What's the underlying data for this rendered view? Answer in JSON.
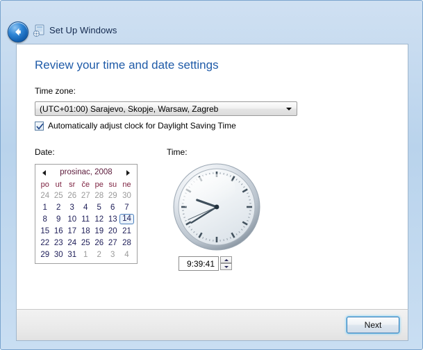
{
  "window": {
    "title": "Set Up Windows",
    "back_icon": "back-arrow-icon",
    "setup_icon": "windows-setup-icon"
  },
  "page": {
    "title": "Review your time and date settings"
  },
  "timezone": {
    "label": "Time zone:",
    "selected": "(UTC+01:00) Sarajevo, Skopje, Warsaw, Zagreb",
    "dropdown_icon": "chevron-down-icon"
  },
  "daylight_saving": {
    "label": "Automatically adjust clock for Daylight Saving Time",
    "checked": true,
    "check_icon": "checkmark-icon"
  },
  "date": {
    "label": "Date:",
    "month_year": "prosinac, 2008",
    "prev_icon": "triangle-left-icon",
    "next_icon": "triangle-right-icon",
    "weekdays": [
      "po",
      "ut",
      "sr",
      "če",
      "pe",
      "su",
      "ne"
    ],
    "weeks": [
      [
        {
          "d": "24",
          "adj": true
        },
        {
          "d": "25",
          "adj": true
        },
        {
          "d": "26",
          "adj": true
        },
        {
          "d": "27",
          "adj": true
        },
        {
          "d": "28",
          "adj": true
        },
        {
          "d": "29",
          "adj": true
        },
        {
          "d": "30",
          "adj": true
        }
      ],
      [
        {
          "d": "1"
        },
        {
          "d": "2"
        },
        {
          "d": "3"
        },
        {
          "d": "4"
        },
        {
          "d": "5"
        },
        {
          "d": "6"
        },
        {
          "d": "7"
        }
      ],
      [
        {
          "d": "8"
        },
        {
          "d": "9"
        },
        {
          "d": "10"
        },
        {
          "d": "11"
        },
        {
          "d": "12"
        },
        {
          "d": "13"
        },
        {
          "d": "14",
          "selected": true
        }
      ],
      [
        {
          "d": "15"
        },
        {
          "d": "16"
        },
        {
          "d": "17"
        },
        {
          "d": "18"
        },
        {
          "d": "19"
        },
        {
          "d": "20"
        },
        {
          "d": "21"
        }
      ],
      [
        {
          "d": "22"
        },
        {
          "d": "23"
        },
        {
          "d": "24"
        },
        {
          "d": "25"
        },
        {
          "d": "26"
        },
        {
          "d": "27"
        },
        {
          "d": "28"
        }
      ],
      [
        {
          "d": "29"
        },
        {
          "d": "30"
        },
        {
          "d": "31"
        },
        {
          "d": "1",
          "adj": true
        },
        {
          "d": "2",
          "adj": true
        },
        {
          "d": "3",
          "adj": true
        },
        {
          "d": "4",
          "adj": true
        }
      ]
    ],
    "selected_day": "14"
  },
  "time": {
    "label": "Time:",
    "value": "9:39:41",
    "clock_icon": "analog-clock-icon",
    "hour": 9,
    "minute": 39,
    "second": 41,
    "spin_up_icon": "triangle-up-icon",
    "spin_down_icon": "triangle-down-icon"
  },
  "footer": {
    "next_label": "Next"
  },
  "colors": {
    "heading": "#1f5ba8",
    "weekday_header": "#7b1f3e",
    "day_text": "#20205a",
    "adjacent_day": "#9a9a9a",
    "selection_border": "#4a7ebb",
    "titlebar_top": "#cfe0f2",
    "titlebar_bottom": "#c9def2",
    "next_glow": "#8fd0f2"
  }
}
